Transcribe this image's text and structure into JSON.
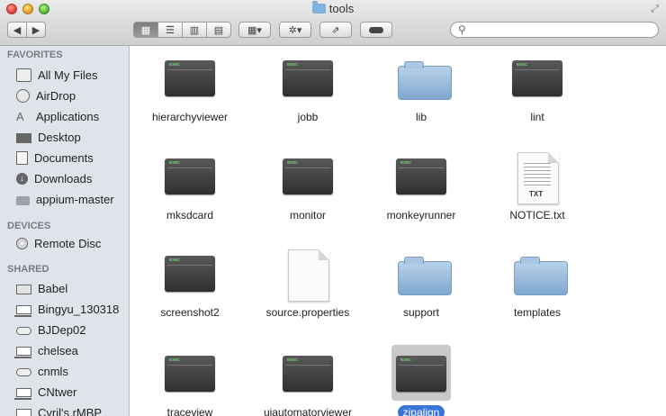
{
  "window": {
    "title": "tools"
  },
  "toolbar": {
    "back_icon": "chevron-left-icon",
    "forward_icon": "chevron-right-icon",
    "view_icons": [
      "icon-view-icon",
      "list-view-icon",
      "column-view-icon",
      "coverflow-view-icon"
    ],
    "search": {
      "placeholder": "",
      "value": ""
    }
  },
  "sidebar": {
    "favorites_label": "FAVORITES",
    "favorites": [
      {
        "label": "All My Files",
        "icon": "all-files-icon"
      },
      {
        "label": "AirDrop",
        "icon": "airdrop-icon"
      },
      {
        "label": "Applications",
        "icon": "applications-icon"
      },
      {
        "label": "Desktop",
        "icon": "desktop-icon"
      },
      {
        "label": "Documents",
        "icon": "documents-icon"
      },
      {
        "label": "Downloads",
        "icon": "downloads-icon"
      },
      {
        "label": "appium-master",
        "icon": "folder-icon"
      }
    ],
    "devices_label": "DEVICES",
    "devices": [
      {
        "label": "Remote Disc",
        "icon": "disc-icon"
      }
    ],
    "shared_label": "SHARED",
    "shared": [
      {
        "label": "Babel",
        "icon": "server-icon"
      },
      {
        "label": "Bingyu_130318",
        "icon": "laptop-icon"
      },
      {
        "label": "BJDep02",
        "icon": "network-drive-icon"
      },
      {
        "label": "chelsea",
        "icon": "laptop-icon"
      },
      {
        "label": "cnmls",
        "icon": "network-drive-icon"
      },
      {
        "label": "CNtwer",
        "icon": "laptop-icon"
      },
      {
        "label": "Cyril's rMBP",
        "icon": "laptop-icon"
      }
    ]
  },
  "files": [
    {
      "name": "hierarchyviewer",
      "kind": "executable"
    },
    {
      "name": "jobb",
      "kind": "executable"
    },
    {
      "name": "lib",
      "kind": "folder"
    },
    {
      "name": "lint",
      "kind": "executable"
    },
    {
      "name": "mksdcard",
      "kind": "executable"
    },
    {
      "name": "monitor",
      "kind": "executable"
    },
    {
      "name": "monkeyrunner",
      "kind": "executable"
    },
    {
      "name": "NOTICE.txt",
      "kind": "text",
      "badge": "TXT"
    },
    {
      "name": "screenshot2",
      "kind": "executable"
    },
    {
      "name": "source.properties",
      "kind": "document"
    },
    {
      "name": "support",
      "kind": "folder"
    },
    {
      "name": "templates",
      "kind": "folder"
    },
    {
      "name": "traceview",
      "kind": "executable"
    },
    {
      "name": "uiautomatorviewer",
      "kind": "executable"
    },
    {
      "name": "zipalign",
      "kind": "executable",
      "selected": true
    }
  ],
  "colors": {
    "sidebar_bg": "#dfe4ea",
    "selection": "#3875d7"
  }
}
